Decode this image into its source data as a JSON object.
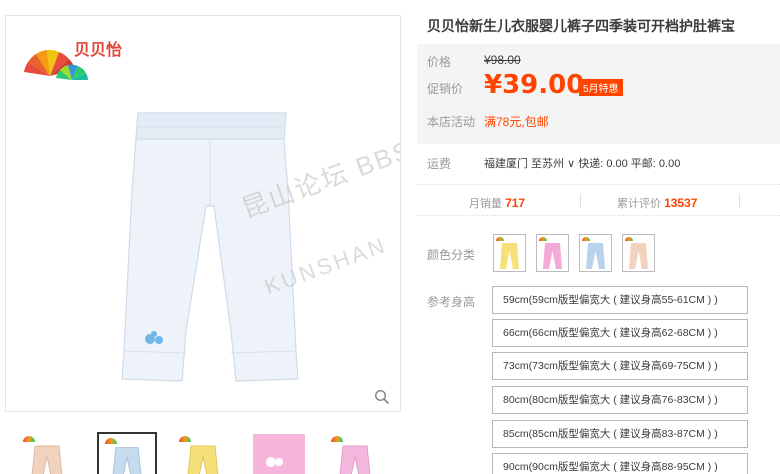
{
  "brand": {
    "logo_text": "贝贝怡"
  },
  "product": {
    "title": "贝贝怡新生儿衣服婴儿裤子四季装可开档护肚裤宝"
  },
  "price": {
    "label": "价格",
    "original": "¥98.00",
    "promo_label": "促销价",
    "promo": "¥39.00",
    "promo_badge": "5月特惠",
    "activity_label": "本店活动",
    "activity": "满78元,包邮"
  },
  "shipping": {
    "label": "运费",
    "value": "福建厦门 至苏州 ∨ 快递: 0.00 平邮: 0.00"
  },
  "stats": {
    "monthly_sales_label": "月销量",
    "monthly_sales": "717",
    "reviews_label": "累计评价",
    "reviews": "13537"
  },
  "watermark": {
    "line1": "昆山论坛 BBS",
    "line2": "KUNSHAN"
  },
  "color_section": {
    "label": "颜色分类",
    "swatches": [
      {
        "name": "yellow",
        "color": "#f5e07a"
      },
      {
        "name": "pink",
        "color": "#f4a9d6"
      },
      {
        "name": "blue",
        "color": "#b9d3ec"
      },
      {
        "name": "beige",
        "color": "#f0d2bf"
      }
    ]
  },
  "size_section": {
    "label": "参考身高",
    "options": [
      "59cm(59cm版型偏宽大 ( 建议身高55-61CM ) )",
      "66cm(66cm版型偏宽大 ( 建议身高62-68CM ) )",
      "73cm(73cm版型偏宽大 ( 建议身高69-75CM ) )",
      "80cm(80cm版型偏宽大 ( 建议身高76-83CM ) )",
      "85cm(85cm版型偏宽大 ( 建议身高83-87CM ) )",
      "90cm(90cm版型偏宽大 ( 建议身高88-95CM ) )"
    ]
  },
  "thumbnails": [
    {
      "name": "beige",
      "color": "#f0d2bf"
    },
    {
      "name": "blue",
      "color": "#c7dbef"
    },
    {
      "name": "yellow",
      "color": "#f5e07a"
    },
    {
      "name": "pink-bag",
      "color": "#f7b5dc"
    },
    {
      "name": "pink",
      "color": "#f4b8de"
    }
  ]
}
